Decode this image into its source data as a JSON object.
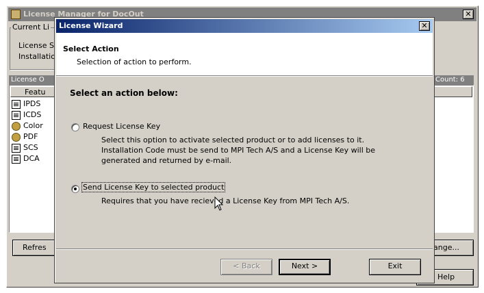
{
  "background_window": {
    "title": "License Manager for DocOut",
    "group_title": "Current Li",
    "license_label": "License S",
    "installation_label": "Installatio",
    "list_header": "License O",
    "count_label": "Count: 6",
    "column_feature": "Featu",
    "items": [
      {
        "label": "IPDS",
        "icon": "document-icon"
      },
      {
        "label": "ICDS",
        "icon": "document-icon"
      },
      {
        "label": "Color",
        "icon": "gear-icon"
      },
      {
        "label": "PDF",
        "icon": "gear-icon"
      },
      {
        "label": "SCS",
        "icon": "document-icon"
      },
      {
        "label": "DCA",
        "icon": "document-icon"
      }
    ],
    "refresh_button": "Refres",
    "change_button": "ange...",
    "help_button": "Help"
  },
  "wizard": {
    "title": "License Wizard",
    "header_title": "Select Action",
    "header_subtitle": "Selection of action to perform.",
    "prompt": "Select an action below:",
    "options": [
      {
        "label": "Request License Key",
        "description": "Select this option to activate selected product or to add licenses to it. Installation Code must be send to MPI Tech A/S and a License Key will be generated and returned by e-mail.",
        "checked": false
      },
      {
        "label": "Send License Key to selected product",
        "description": "Requires that you have recieved a License Key from MPI Tech A/S.",
        "checked": true
      }
    ],
    "back_button": "< Back",
    "next_button": "Next >",
    "exit_button": "Exit"
  }
}
